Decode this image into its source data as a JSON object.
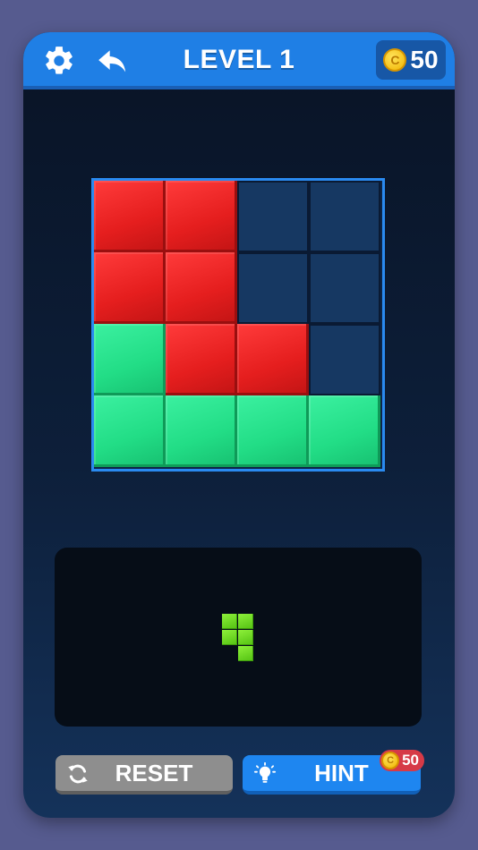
{
  "header": {
    "level_label": "LEVEL 1",
    "coins": "50",
    "coin_symbol": "C"
  },
  "board": {
    "rows": 4,
    "cols": 4,
    "cells": [
      [
        "red",
        "red",
        "empty",
        "empty"
      ],
      [
        "red",
        "red",
        "empty",
        "empty"
      ],
      [
        "green",
        "red",
        "red",
        "empty"
      ],
      [
        "green",
        "green",
        "green",
        "green"
      ]
    ]
  },
  "tray": {
    "piece_cells": [
      [
        0,
        0
      ],
      [
        0,
        1
      ],
      [
        1,
        0
      ],
      [
        1,
        1
      ],
      [
        2,
        1
      ]
    ],
    "piece_color": "#7ddc2a"
  },
  "buttons": {
    "reset_label": "RESET",
    "hint_label": "HINT",
    "hint_cost": "50"
  },
  "colors": {
    "accent": "#1f7fe5",
    "red_block": "#e51e1e",
    "green_block": "#22dd86",
    "empty_cell": "#163862"
  }
}
